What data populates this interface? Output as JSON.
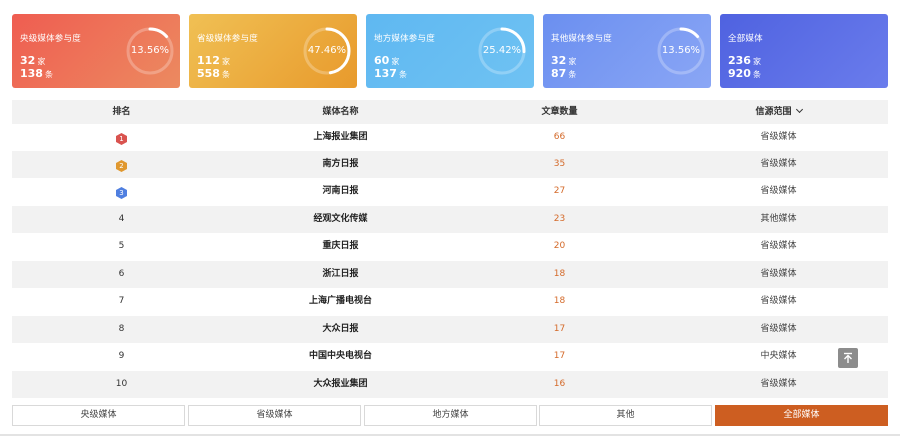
{
  "cards": [
    {
      "title": "央级媒体参与度",
      "line1_num": "32",
      "line1_unit": "家",
      "line2_num": "138",
      "line2_unit": "条",
      "percent": "13.56%",
      "ratio": 0.1356
    },
    {
      "title": "省级媒体参与度",
      "line1_num": "112",
      "line1_unit": "家",
      "line2_num": "558",
      "line2_unit": "条",
      "percent": "47.46%",
      "ratio": 0.4746
    },
    {
      "title": "地方媒体参与度",
      "line1_num": "60",
      "line1_unit": "家",
      "line2_num": "137",
      "line2_unit": "条",
      "percent": "25.42%",
      "ratio": 0.2542
    },
    {
      "title": "其他媒体参与度",
      "line1_num": "32",
      "line1_unit": "家",
      "line2_num": "87",
      "line2_unit": "条",
      "percent": "13.56%",
      "ratio": 0.1356
    },
    {
      "title": "全部媒体",
      "line1_num": "236",
      "line1_unit": "家",
      "line2_num": "920",
      "line2_unit": "条"
    }
  ],
  "table": {
    "headers": [
      "排名",
      "媒体名称",
      "文章数量",
      "信源范围"
    ],
    "rows": [
      {
        "rank": "1",
        "name": "上海报业集团",
        "count": "66",
        "scope": "省级媒体"
      },
      {
        "rank": "2",
        "name": "南方日报",
        "count": "35",
        "scope": "省级媒体"
      },
      {
        "rank": "3",
        "name": "河南日报",
        "count": "27",
        "scope": "省级媒体"
      },
      {
        "rank": "4",
        "name": "经观文化传媒",
        "count": "23",
        "scope": "其他媒体"
      },
      {
        "rank": "5",
        "name": "重庆日报",
        "count": "20",
        "scope": "省级媒体"
      },
      {
        "rank": "6",
        "name": "浙江日报",
        "count": "18",
        "scope": "省级媒体"
      },
      {
        "rank": "7",
        "name": "上海广播电视台",
        "count": "18",
        "scope": "省级媒体"
      },
      {
        "rank": "8",
        "name": "大众日报",
        "count": "17",
        "scope": "省级媒体"
      },
      {
        "rank": "9",
        "name": "中国中央电视台",
        "count": "17",
        "scope": "中央媒体"
      },
      {
        "rank": "10",
        "name": "大众报业集团",
        "count": "16",
        "scope": "省级媒体"
      }
    ]
  },
  "tabs": [
    "央级媒体",
    "省级媒体",
    "地方媒体",
    "其他",
    "全部媒体"
  ],
  "active_tab": "全部媒体",
  "colors": {
    "card_gradients": [
      [
        "#ef5d51",
        "#ec8a60"
      ],
      [
        "#f0c054",
        "#e89a2c"
      ],
      [
        "#5fb8f1",
        "#6fc2f3"
      ],
      [
        "#6b8ff0",
        "#8aa6f5"
      ],
      [
        "#4f62e0",
        "#6a7cec"
      ]
    ],
    "medals": [
      "#d9534f",
      "#e0982f",
      "#4f7fe0"
    ],
    "count": "#d46a2a",
    "active_tab": "#cd5e21"
  },
  "icons": {
    "scroll_top": "arrow-up-to-line-icon",
    "dropdown": "chevron-down-icon"
  }
}
